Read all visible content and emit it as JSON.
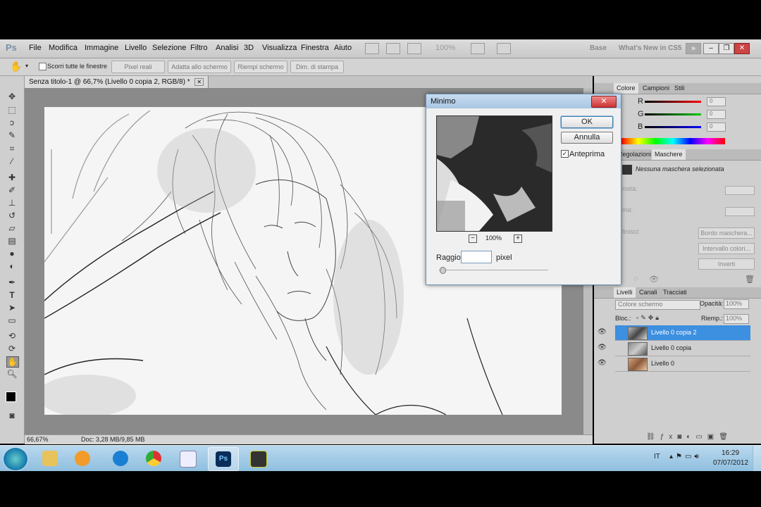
{
  "app": {
    "logo": "Ps",
    "menu": [
      "File",
      "Modifica",
      "Immagine",
      "Livello",
      "Selezione",
      "Filtro",
      "Analisi",
      "3D",
      "Visualizza",
      "Finestra",
      "Aiuto"
    ],
    "zoom_field": "100%",
    "workspace_base": "Base",
    "workspace_whats_new": "What's New in CS5",
    "window_controls": [
      "–",
      "❐",
      "✕"
    ]
  },
  "options_bar": {
    "checkbox_label": "Scorri tutte le finestre",
    "buttons": [
      "Pixel reali",
      "Adatta allo schermo",
      "Riempi schermo",
      "Dim. di stampa"
    ]
  },
  "document": {
    "tab_title": "Senza titolo-1 @ 66,7% (Livello 0 copia 2, RGB/8) *",
    "tab_close": "✕",
    "status_zoom": "66,67%",
    "status_doc": "Doc: 3,28 MB/9,85 MB"
  },
  "dialog": {
    "title": "Minimo",
    "close": "✕",
    "ok": "OK",
    "cancel": "Annulla",
    "preview_label": "Anteprima",
    "preview_checked": true,
    "zoom_minus": "−",
    "zoom_value": "100%",
    "zoom_plus": "+",
    "radius_label": "Raggio:",
    "radius_value": "",
    "radius_unit": "pixel"
  },
  "color_panel": {
    "tabs": [
      "Colore",
      "Campioni",
      "Stili"
    ],
    "channels": [
      {
        "label": "R",
        "value": "0",
        "color": "#e03030"
      },
      {
        "label": "G",
        "value": "0",
        "color": "#30b030"
      },
      {
        "label": "B",
        "value": "0",
        "color": "#3050e0"
      }
    ]
  },
  "masks_panel": {
    "tabs": [
      "Regolazioni",
      "Maschere"
    ],
    "status": "Nessuna maschera selezionata",
    "field_density": "nsità:",
    "field_feather": "ma:",
    "field_refine": "finisci:",
    "buttons": [
      "Bordo maschera...",
      "Intervallo colori...",
      "Inverti"
    ]
  },
  "layers_panel": {
    "tabs": [
      "Livelli",
      "Canali",
      "Tracciati"
    ],
    "blend_mode": "Colore schermo",
    "opacity_label": "Opacità:",
    "opacity_value": "100%",
    "lock_label": "Bloc.:",
    "fill_label": "Riemp.:",
    "fill_value": "100%",
    "layers": [
      {
        "name": "Livello 0 copia 2",
        "selected": true
      },
      {
        "name": "Livello 0 copia",
        "selected": false
      },
      {
        "name": "Livello 0",
        "selected": false
      }
    ]
  },
  "taskbar": {
    "language": "IT",
    "time": "16:29",
    "date": "07/07/2012",
    "apps": [
      "windows-start",
      "explorer",
      "media-player",
      "internet-explorer",
      "chrome",
      "paint",
      "photoshop",
      "hypercam"
    ],
    "active_app": "photoshop"
  }
}
